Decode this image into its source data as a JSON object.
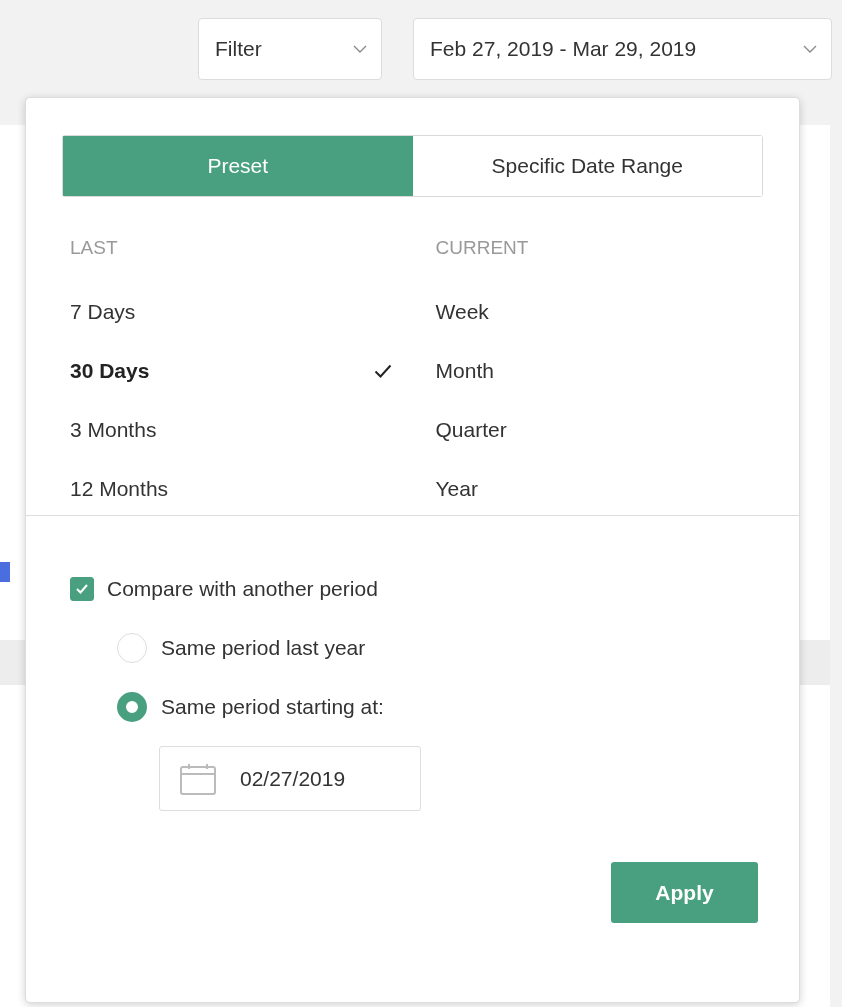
{
  "toolbar": {
    "filter": {
      "label": "Filter"
    },
    "date_range": {
      "label": "Feb 27, 2019 - Mar 29, 2019"
    }
  },
  "popover": {
    "tabs": [
      {
        "label": "Preset",
        "selected": true
      },
      {
        "label": "Specific Date Range",
        "selected": false
      }
    ],
    "columns": [
      {
        "header": "LAST",
        "items": [
          {
            "label": "7 Days",
            "selected": false
          },
          {
            "label": "30 Days",
            "selected": true
          },
          {
            "label": "3 Months",
            "selected": false
          },
          {
            "label": "12 Months",
            "selected": false
          }
        ]
      },
      {
        "header": "CURRENT",
        "items": [
          {
            "label": "Week",
            "selected": false
          },
          {
            "label": "Month",
            "selected": false
          },
          {
            "label": "Quarter",
            "selected": false
          },
          {
            "label": "Year",
            "selected": false
          }
        ]
      }
    ],
    "compare": {
      "label": "Compare with another period",
      "checked": true
    },
    "options": [
      {
        "label": "Same period last year",
        "selected": false
      },
      {
        "label": "Same period starting at:",
        "selected": true
      }
    ],
    "start_date": {
      "value": "02/27/2019"
    },
    "apply": {
      "label": "Apply"
    }
  }
}
